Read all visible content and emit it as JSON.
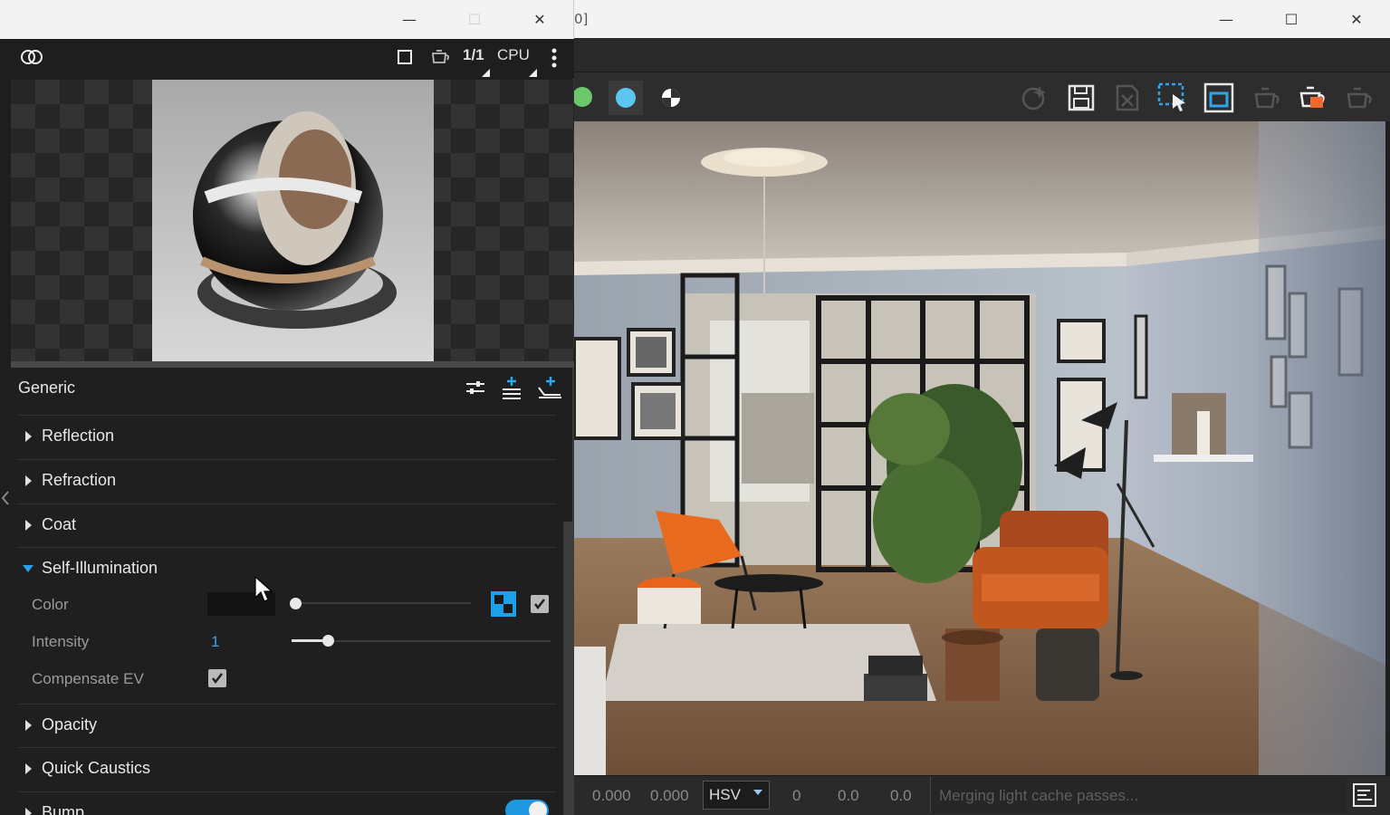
{
  "vfb": {
    "title_fragment": "0]",
    "window_controls": {
      "minimize": "—",
      "maximize": "☐",
      "close": "✕"
    },
    "channel_colors": [
      "#6cc76a",
      "#5cc6f0"
    ],
    "toolbar_icons": [
      "sparkle-render-icon",
      "save-icon",
      "clear-image-icon",
      "region-select-icon",
      "render-region-icon",
      "teapot-icon",
      "render-teapot-icon",
      "teapot-outline-icon"
    ],
    "status": {
      "x": "0.000",
      "y": "0.000",
      "color_mode": "HSV",
      "h": "0",
      "s": "0.0",
      "v": "0.0",
      "message": "Merging light cache passes..."
    }
  },
  "material_editor": {
    "window_controls": {
      "minimize": "—",
      "maximize": "☐",
      "close": "✕"
    },
    "preview_toolbar": {
      "ratio": "1/1",
      "engine": "CPU"
    },
    "panel_title": "Generic",
    "rollouts": [
      {
        "label": "Reflection",
        "open": false
      },
      {
        "label": "Refraction",
        "open": false
      },
      {
        "label": "Coat",
        "open": false
      },
      {
        "label": "Self-Illumination",
        "open": true
      },
      {
        "label": "Opacity",
        "open": false
      },
      {
        "label": "Quick Caustics",
        "open": false
      },
      {
        "label": "Bump",
        "open": false
      }
    ],
    "self_illumination": {
      "color_label": "Color",
      "intensity_label": "Intensity",
      "intensity_value": "1",
      "intensity_slider": 0.12,
      "color_slider": 0.0,
      "compensate_label": "Compensate EV",
      "compensate_checked": true,
      "color_enabled": true
    },
    "bump_enabled": true
  },
  "colors": {
    "accent": "#26a3e8",
    "render_accent": "#ef6a2a"
  }
}
